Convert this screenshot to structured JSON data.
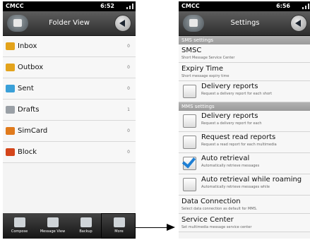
{
  "left_screen": {
    "status": {
      "carrier": "CMCC",
      "time": "6:52"
    },
    "title": "Folder View",
    "folders": [
      {
        "name": "Inbox",
        "count": "0",
        "icon": "inbox-folder-icon",
        "color": "#e3a31c"
      },
      {
        "name": "Outbox",
        "count": "0",
        "icon": "outbox-folder-icon",
        "color": "#e3a31c"
      },
      {
        "name": "Sent",
        "count": "0",
        "icon": "sent-folder-icon",
        "color": "#3aa0d8"
      },
      {
        "name": "Drafts",
        "count": "1",
        "icon": "drafts-folder-icon",
        "color": "#9aa0a6"
      },
      {
        "name": "SimCard",
        "count": "0",
        "icon": "simcard-folder-icon",
        "color": "#e07a1c"
      },
      {
        "name": "Block",
        "count": "0",
        "icon": "block-folder-icon",
        "color": "#d4451a"
      }
    ],
    "tabs": [
      {
        "label": "Compose",
        "icon": "compose-icon"
      },
      {
        "label": "Message View",
        "icon": "list-icon"
      },
      {
        "label": "Backup",
        "icon": "backup-icon"
      },
      {
        "label": "More",
        "icon": "more-icon"
      }
    ]
  },
  "right_screen": {
    "status": {
      "carrier": "CMCC",
      "time": "6:56"
    },
    "title": "Settings",
    "sms_section": "SMS settings",
    "mms_section": "MMS settings",
    "sms_items": [
      {
        "title": "SMSC",
        "subtitle": "Short Message Service Center"
      },
      {
        "title": "Expiry Time",
        "subtitle": "Short message expiry time"
      },
      {
        "title": "Delivery reports",
        "subtitle": "Request a delivery report for each short",
        "checked": false
      }
    ],
    "mms_items": [
      {
        "title": "Delivery reports",
        "subtitle": "Request a delivery report for each",
        "checked": false
      },
      {
        "title": "Request read reports",
        "subtitle": "Request a read report for each multimedia",
        "checked": false
      },
      {
        "title": "Auto retrieval",
        "subtitle": "Automatically retrieve messages",
        "checked": true
      },
      {
        "title": "Auto retrieval while roaming",
        "subtitle": "Automatically retrieve messages while",
        "checked": false
      }
    ],
    "extra_items": [
      {
        "title": "Data Connection",
        "subtitle": "Select data connection as default for MMS."
      },
      {
        "title": "Service Center",
        "subtitle": "Set multimedia message service center"
      }
    ]
  },
  "accent_color": "#1e7fd4"
}
